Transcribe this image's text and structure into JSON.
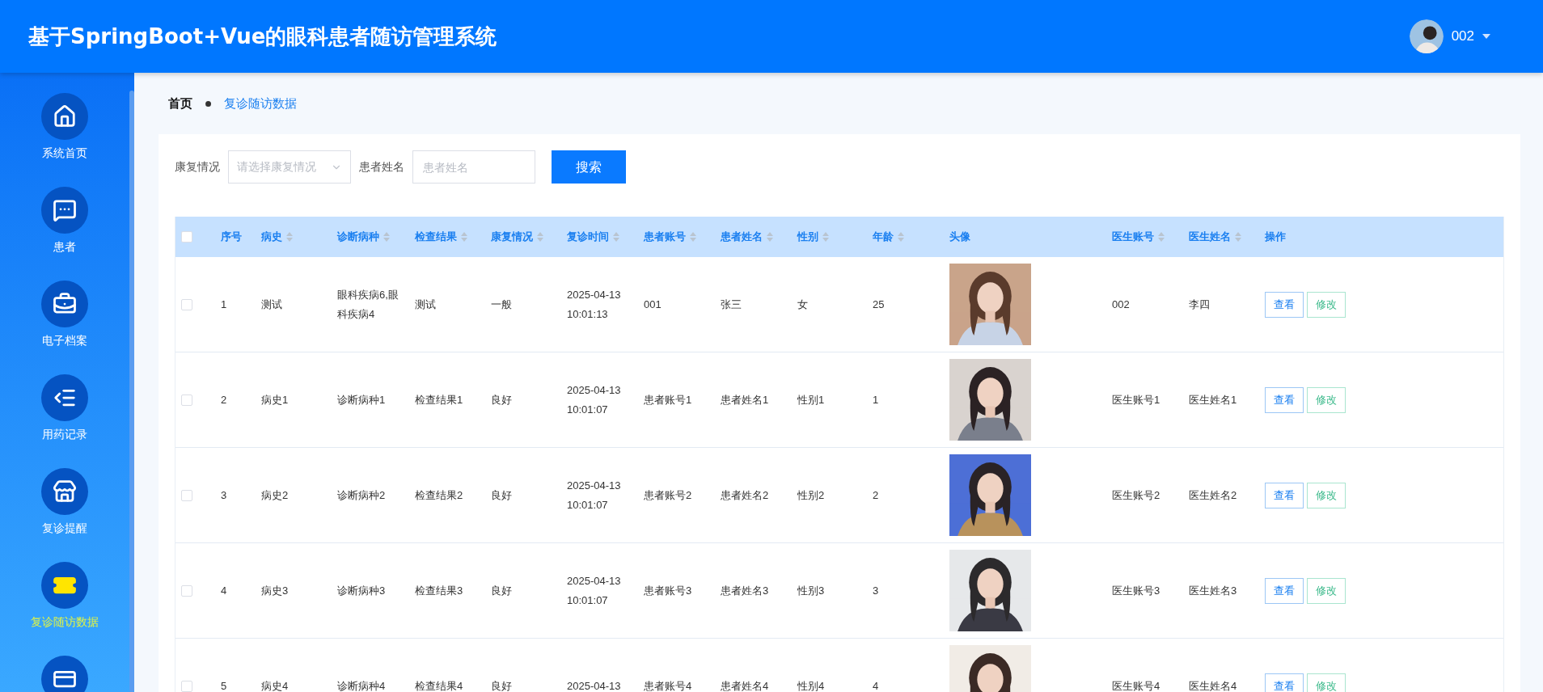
{
  "header": {
    "title": "基于SpringBoot+Vue的眼科患者随访管理系统",
    "user": {
      "name": "002"
    }
  },
  "sidebar": {
    "items": [
      {
        "label": "系统首页",
        "selected": false
      },
      {
        "label": "患者",
        "selected": false
      },
      {
        "label": "电子档案",
        "selected": false
      },
      {
        "label": "用药记录",
        "selected": false
      },
      {
        "label": "复诊提醒",
        "selected": false
      },
      {
        "label": "复诊随访数据",
        "selected": true
      },
      {
        "selected": false
      }
    ]
  },
  "breadcrumb": [
    {
      "label": "首页"
    },
    {
      "label": "复诊随访数据"
    }
  ],
  "filters": [
    {
      "kind": "select",
      "label": "康复情况",
      "placeholder": "请选择康复情况"
    },
    {
      "kind": "text",
      "label": "患者姓名",
      "placeholder": "患者姓名"
    }
  ],
  "search_button": "搜索",
  "table": {
    "all_checked": false,
    "columns": [
      {
        "label": "序号",
        "sortable": false
      },
      {
        "label": "病史",
        "sortable": true
      },
      {
        "label": "诊断病种",
        "sortable": true
      },
      {
        "label": "检查结果",
        "sortable": true
      },
      {
        "label": "康复情况",
        "sortable": true
      },
      {
        "label": "复诊时间",
        "sortable": true
      },
      {
        "label": "患者账号",
        "sortable": true
      },
      {
        "label": "患者姓名",
        "sortable": true
      },
      {
        "label": "性别",
        "sortable": true
      },
      {
        "label": "年龄",
        "sortable": true
      },
      {
        "label": "头像",
        "sortable": false
      },
      {
        "label": "医生账号",
        "sortable": true
      },
      {
        "label": "医生姓名",
        "sortable": true
      },
      {
        "label": "操作",
        "sortable": false
      }
    ],
    "rows": [
      {
        "checked": false,
        "cells": [
          "1",
          "测试",
          "眼科疾病6,眼科疾病4",
          "测试",
          "一般",
          "2025-04-13 10:01:13",
          "001",
          "张三",
          "女",
          "25"
        ],
        "doctor": [
          "002",
          "李四"
        ],
        "actions": [
          {
            "kind": "view",
            "label": "查看"
          },
          {
            "kind": "edit",
            "label": "修改"
          }
        ]
      },
      {
        "checked": false,
        "cells": [
          "2",
          "病史1",
          "诊断病种1",
          "检查结果1",
          "良好",
          "2025-04-13 10:01:07",
          "患者账号1",
          "患者姓名1",
          "性别1",
          "1"
        ],
        "doctor": [
          "医生账号1",
          "医生姓名1"
        ],
        "actions": [
          {
            "kind": "view",
            "label": "查看"
          },
          {
            "kind": "edit",
            "label": "修改"
          }
        ]
      },
      {
        "checked": false,
        "cells": [
          "3",
          "病史2",
          "诊断病种2",
          "检查结果2",
          "良好",
          "2025-04-13 10:01:07",
          "患者账号2",
          "患者姓名2",
          "性别2",
          "2"
        ],
        "doctor": [
          "医生账号2",
          "医生姓名2"
        ],
        "actions": [
          {
            "kind": "view",
            "label": "查看"
          },
          {
            "kind": "edit",
            "label": "修改"
          }
        ]
      },
      {
        "checked": false,
        "cells": [
          "4",
          "病史3",
          "诊断病种3",
          "检查结果3",
          "良好",
          "2025-04-13 10:01:07",
          "患者账号3",
          "患者姓名3",
          "性别3",
          "3"
        ],
        "doctor": [
          "医生账号3",
          "医生姓名3"
        ],
        "actions": [
          {
            "kind": "view",
            "label": "查看"
          },
          {
            "kind": "edit",
            "label": "修改"
          }
        ]
      },
      {
        "checked": false,
        "cells": [
          "5",
          "病史4",
          "诊断病种4",
          "检查结果4",
          "良好",
          "2025-04-13",
          "患者账号4",
          "患者姓名4",
          "性别4",
          "4"
        ],
        "doctor": [
          "医生账号4",
          "医生姓名4"
        ],
        "actions": [
          {
            "kind": "view",
            "label": "查看"
          },
          {
            "kind": "edit",
            "label": "修改"
          }
        ]
      }
    ]
  }
}
